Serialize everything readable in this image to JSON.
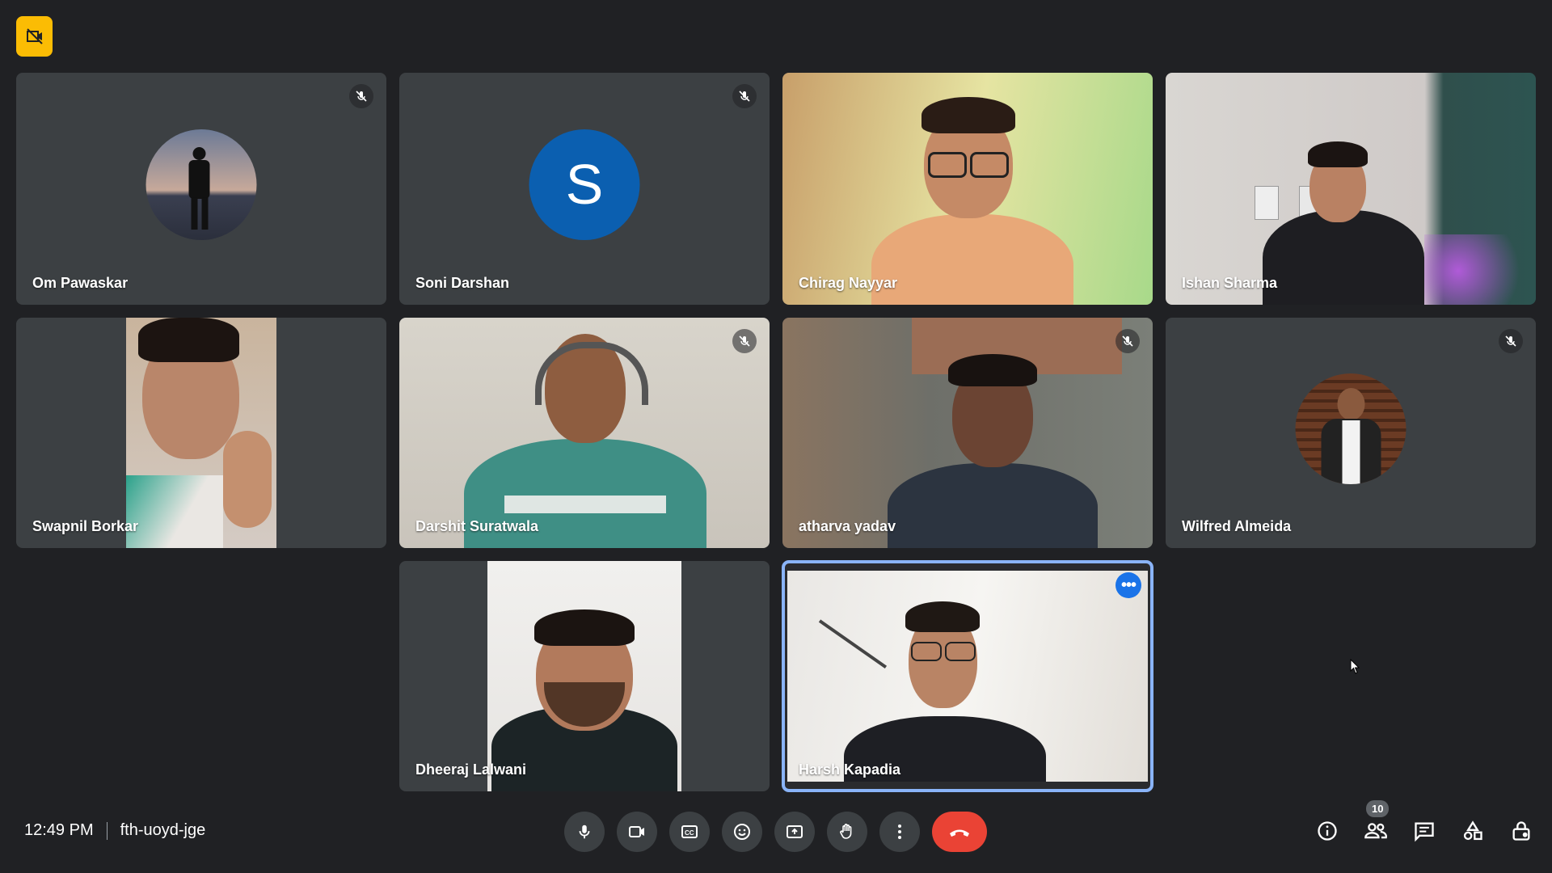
{
  "meeting": {
    "time": "12:49 PM",
    "code": "fth-uoyd-jge",
    "participant_count": "10"
  },
  "participants": [
    {
      "name": "Om Pawaskar",
      "muted": true,
      "display": "avatar-photo"
    },
    {
      "name": "Soni Darshan",
      "muted": true,
      "display": "letter-avatar",
      "initial": "S",
      "avatar_color": "#0b5fb0"
    },
    {
      "name": "Chirag Nayyar",
      "muted": false,
      "display": "video"
    },
    {
      "name": "Ishan Sharma",
      "muted": false,
      "display": "video"
    },
    {
      "name": "Swapnil Borkar",
      "muted": false,
      "display": "video"
    },
    {
      "name": "Darshit Suratwala",
      "muted": true,
      "display": "video"
    },
    {
      "name": "atharva yadav",
      "muted": true,
      "display": "video"
    },
    {
      "name": "Wilfred Almeida",
      "muted": true,
      "display": "avatar-photo"
    },
    {
      "name": "Dheeraj Lalwani",
      "muted": false,
      "display": "video"
    },
    {
      "name": "Harsh Kapadia",
      "muted": false,
      "display": "video",
      "selected": true
    }
  ],
  "controls": [
    {
      "icon": "microphone-icon"
    },
    {
      "icon": "camera-icon"
    },
    {
      "icon": "captions-icon"
    },
    {
      "icon": "emoji-icon"
    },
    {
      "icon": "present-screen-icon"
    },
    {
      "icon": "raise-hand-icon"
    },
    {
      "icon": "more-options-icon"
    },
    {
      "icon": "leave-call-icon",
      "color": "#ea4335"
    }
  ],
  "right_panel_icons": [
    {
      "icon": "info-icon"
    },
    {
      "icon": "people-icon"
    },
    {
      "icon": "chat-icon"
    },
    {
      "icon": "activities-icon"
    },
    {
      "icon": "host-controls-icon"
    }
  ],
  "colors": {
    "background": "#202124",
    "tile": "#3c4043",
    "accent": "#8ab4f8",
    "end_call": "#ea4335",
    "top_badge": "#fbbc04"
  }
}
